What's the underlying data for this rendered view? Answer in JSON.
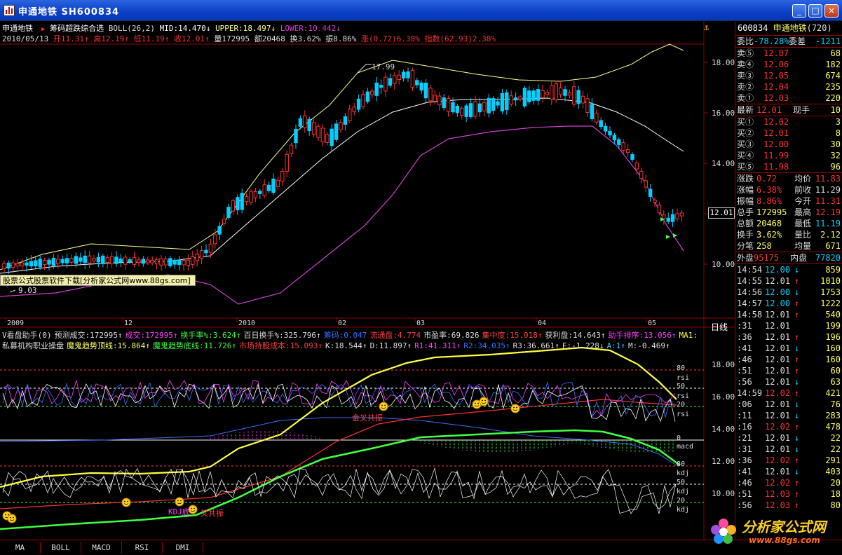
{
  "window": {
    "title": "申通地铁  SH600834",
    "min": "_",
    "max": "□",
    "close": "×"
  },
  "main": {
    "stock_name": "申通地铁",
    "indicator_name": "筹码超跌综合选",
    "boll": "BOLL(26,2)",
    "mid": "MID:14.470",
    "upper": "UPPER:18.497",
    "lower": "LOWER:10.442",
    "date": "2010/05/13",
    "open": "开11.31",
    "high": "高12.19",
    "low": "低11.19",
    "close": "收12.01",
    "volume": "量172995",
    "amount": "额20468",
    "turnover": "换3.62%",
    "amplitude": "振8.86%",
    "change": "涨(0.72)6.38%",
    "index": "指数(62.93)2.38%",
    "peak_label": "17.99",
    "low_label": "9.03",
    "price_tag": "12.01",
    "price_axis": [
      "18.00",
      "16.00",
      "14.00",
      "12.00",
      "10.00"
    ],
    "date_axis": [
      "2009",
      "12",
      "2010",
      "02",
      "03",
      "04",
      "05"
    ],
    "period": "日线"
  },
  "sub": {
    "line1": [
      {
        "t": "V看盘助手(0)",
        "c": "#dddddd"
      },
      {
        "t": "预测成交:172995↑",
        "c": "#dddddd"
      },
      {
        "t": "成交:172995↑",
        "c": "#ff40ff"
      },
      {
        "t": "换手率%:3.624↑",
        "c": "#40ff40"
      },
      {
        "t": "百日换手%:325.796↑",
        "c": "#dddddd"
      },
      {
        "t": "筹码:0.047",
        "c": "#3070ff"
      },
      {
        "t": "流通盘:4.774",
        "c": "#ff4040"
      },
      {
        "t": "市盈率:69.826",
        "c": "#dddddd"
      },
      {
        "t": "集中度:15.018↑",
        "c": "#ff4040"
      },
      {
        "t": "获利盘:14.643↑",
        "c": "#dddddd"
      },
      {
        "t": "助手排序:13.056↑",
        "c": "#ff40ff"
      },
      {
        "t": "MA1:",
        "c": "#ffff40"
      }
    ],
    "line2": [
      {
        "t": "私募机构职业操盘",
        "c": "#dddddd"
      },
      {
        "t": "魔鬼趋势顶线:15.864↑",
        "c": "#ffff60"
      },
      {
        "t": "魔鬼趋势底线:11.726↑",
        "c": "#40ff40"
      },
      {
        "t": "市场持股成本:15.093↑",
        "c": "#ff4040"
      },
      {
        "t": "K:18.544↑",
        "c": "#dddddd"
      },
      {
        "t": "D:11.897↑",
        "c": "#dddddd"
      },
      {
        "t": "R1:41.311↑",
        "c": "#ff40ff"
      },
      {
        "t": "R2:34.035↑",
        "c": "#3070ff"
      },
      {
        "t": "R3:36.661↑",
        "c": "#dddddd"
      },
      {
        "t": "F:-1.228↓",
        "c": "#dddddd"
      },
      {
        "t": "A:1↑",
        "c": "#40c0ff"
      },
      {
        "t": "M:-0.469↑",
        "c": "#dddddd"
      }
    ],
    "axis": [
      "18.00",
      "16.00",
      "14.00",
      "12.00",
      "10.00"
    ],
    "rsi_labels": [
      "80",
      "rsi",
      "50",
      "rsi",
      "20",
      "rsi"
    ],
    "macd_labels": [
      "0",
      "macd"
    ],
    "kdj_labels": [
      "80",
      "kdj",
      "50",
      "kdj",
      "20",
      "kdj"
    ],
    "signal1": "金叉共振",
    "signal2": "KDJ底",
    "signal3": "叉共振"
  },
  "watermark": "股票公式股票软件下载[分析家公式网www.88gs.com]",
  "panel": {
    "code": "600834",
    "name": "申通地铁",
    "num": "(720)",
    "weibi_label": "委比",
    "weibi": "-78.28%",
    "weicha_label": "委差",
    "weicha": "-1211",
    "sell": [
      {
        "label": "卖⑤",
        "price": "12.07",
        "vol": "68"
      },
      {
        "label": "卖④",
        "price": "12.06",
        "vol": "182"
      },
      {
        "label": "卖③",
        "price": "12.05",
        "vol": "674"
      },
      {
        "label": "卖②",
        "price": "12.04",
        "vol": "235"
      },
      {
        "label": "卖①",
        "price": "12.03",
        "vol": "220"
      }
    ],
    "last_label": "最新",
    "last": "12.01",
    "xianshou_label": "现手",
    "xianshou": "10",
    "buy": [
      {
        "label": "买①",
        "price": "12.02",
        "vol": "3"
      },
      {
        "label": "买②",
        "price": "12.01",
        "vol": "8"
      },
      {
        "label": "买③",
        "price": "12.00",
        "vol": "30"
      },
      {
        "label": "买④",
        "price": "11.99",
        "vol": "32"
      },
      {
        "label": "买⑤",
        "price": "11.98",
        "vol": "96"
      }
    ],
    "stats": [
      {
        "a": "涨跌",
        "av": "0.72",
        "b": "均价",
        "bv": "11.83"
      },
      {
        "a": "涨幅",
        "av": "6.38%",
        "b": "前收",
        "bv": "11.29"
      },
      {
        "a": "振幅",
        "av": "8.86%",
        "b": "今开",
        "bv": "11.31"
      },
      {
        "a": "总手",
        "av": "172995",
        "b": "最高",
        "bv": "12.19"
      },
      {
        "a": "总额",
        "av": "20468",
        "b": "最低",
        "bv": "11.19"
      },
      {
        "a": "换手",
        "av": "3.62%",
        "b": "量比",
        "bv": "2.12"
      },
      {
        "a": "分笔",
        "av": "258",
        "b": "均量",
        "bv": "671"
      }
    ],
    "waipan_label": "外盘",
    "waipan": "95175",
    "neipan_label": "内盘",
    "neipan": "77820",
    "ticks": [
      {
        "time": "14:54",
        "price": "12.00",
        "dir": "↓",
        "vol": "859"
      },
      {
        "time": "14:55",
        "price": "12.01",
        "dir": "↑",
        "vol": "1010"
      },
      {
        "time": "14:56",
        "price": "12.00",
        "dir": "↓",
        "vol": "1753"
      },
      {
        "time": "14:57",
        "price": "12.00",
        "dir": "↑",
        "vol": "1222"
      },
      {
        "time": "14:58",
        "price": "12.01",
        "dir": "↑",
        "vol": "540"
      },
      {
        "time": ":31",
        "price": "12.01",
        "dir": "",
        "vol": "199"
      },
      {
        "time": ":36",
        "price": "12.01",
        "dir": "↑",
        "vol": "196"
      },
      {
        "time": ":41",
        "price": "12.01",
        "dir": "↓",
        "vol": "160"
      },
      {
        "time": ":46",
        "price": "12.01",
        "dir": "↑",
        "vol": "160"
      },
      {
        "time": ":51",
        "price": "12.01",
        "dir": "↑",
        "vol": "60"
      },
      {
        "time": ":56",
        "price": "12.01",
        "dir": "↓",
        "vol": "63"
      },
      {
        "time": "14:59",
        "price": "12.02",
        "dir": "↑",
        "vol": "421"
      },
      {
        "time": ":06",
        "price": "12.01",
        "dir": "↓",
        "vol": "76"
      },
      {
        "time": ":11",
        "price": "12.01",
        "dir": "↓",
        "vol": "283"
      },
      {
        "time": ":16",
        "price": "12.02",
        "dir": "↑",
        "vol": "478"
      },
      {
        "time": ":21",
        "price": "12.01",
        "dir": "↓",
        "vol": "22"
      },
      {
        "time": ":31",
        "price": "12.01",
        "dir": "↓",
        "vol": "22"
      },
      {
        "time": ":36",
        "price": "12.02",
        "dir": "↑",
        "vol": "291"
      },
      {
        "time": ":41",
        "price": "12.01",
        "dir": "↓",
        "vol": "403"
      },
      {
        "time": ":46",
        "price": "12.02",
        "dir": "↑",
        "vol": "20"
      },
      {
        "time": ":51",
        "price": "12.03",
        "dir": "↑",
        "vol": "18"
      },
      {
        "time": ":56",
        "price": "12.03",
        "dir": "↑",
        "vol": "80"
      }
    ]
  },
  "tabs": [
    "MA",
    "BOLL",
    "MACD",
    "RSI",
    "DMI"
  ],
  "logo": {
    "name": "分析家公式网",
    "url": "www.88gs.com"
  },
  "colors": {
    "up": "#ff3030",
    "down": "#00d0ff",
    "upper": "#ffff90",
    "mid": "#ffffff",
    "lower": "#d040d0",
    "grid": "#900000"
  }
}
